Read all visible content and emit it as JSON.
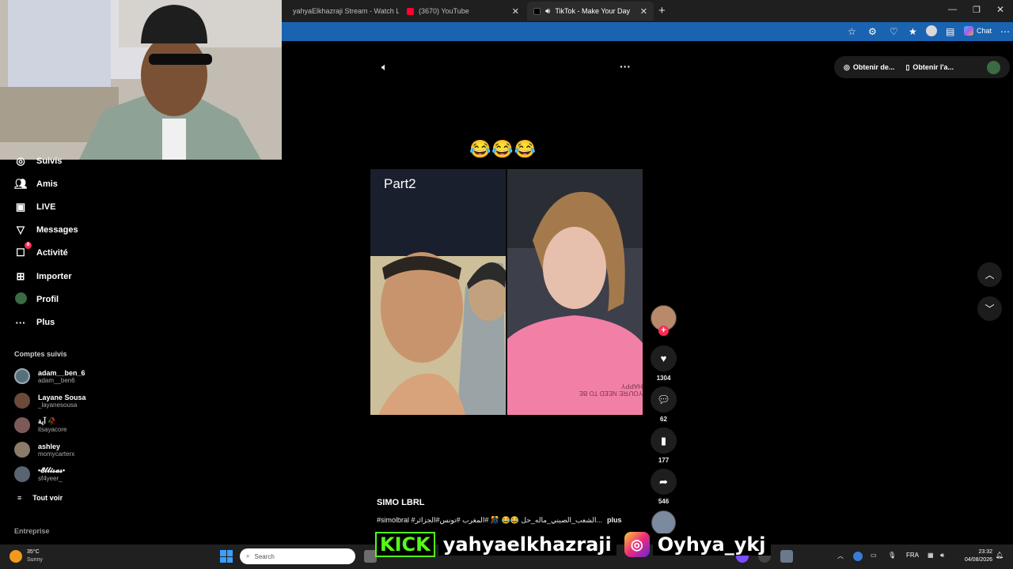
{
  "browser": {
    "tabs": [
      {
        "label": "yahyaElkhazraji Stream - Watch Li..."
      },
      {
        "label": "(3670) YouTube"
      },
      {
        "label": "TikTok - Make Your Day"
      }
    ],
    "chat_label": "Chat"
  },
  "sidebar": {
    "items": [
      {
        "label": "Suivis",
        "icon": "users-icon"
      },
      {
        "label": "Amis",
        "icon": "friends-icon"
      },
      {
        "label": "LIVE",
        "icon": "live-icon"
      },
      {
        "label": "Messages",
        "icon": "send-icon"
      },
      {
        "label": "Activité",
        "icon": "inbox-icon",
        "badge": "8"
      },
      {
        "label": "Importer",
        "icon": "plus-square-icon"
      },
      {
        "label": "Profil",
        "icon": "profile-icon"
      },
      {
        "label": "Plus",
        "icon": "more-icon"
      }
    ],
    "following_title": "Comptes suivis",
    "accounts": [
      {
        "name": "adam__ben_6",
        "handle": "adam__ben6"
      },
      {
        "name": "Layane Sousa",
        "handle": "_layanesousa"
      },
      {
        "name": "آية 🥀",
        "handle": "itsayacore"
      },
      {
        "name": "ashley",
        "handle": "momycarterx"
      },
      {
        "name": "•𝓔𝓵𝓵𝓲𝓼𝓪𝓼•",
        "handle": "sf4yeer_"
      }
    ],
    "see_all": "Tout voir",
    "footer": "Entreprise"
  },
  "topbar": {
    "get_coins": "Obtenir de...",
    "get_app": "Obtenir l'a..."
  },
  "video": {
    "caption_emojis": "😂😂😂",
    "part_label": "Part2",
    "shirt_text": "YOU'RE NEED TO BE HAPPY",
    "author": "SIMO LBRL",
    "description": "#simolbral #الشعب_الصيني_ماله_حل 😂😂 🎊 #المغرب #تونس#الجزائر...",
    "more": "plus"
  },
  "actions": {
    "likes": "1304",
    "comments": "62",
    "saves": "177",
    "shares": "546"
  },
  "overlay": {
    "kick": "KICK",
    "kick_user": "yahyaelkhazraji",
    "ig_user": "Oyhya_ykj"
  },
  "taskbar": {
    "weather_temp": "35°C",
    "weather_desc": "Sunny",
    "search_placeholder": "Search",
    "lang": "FRA",
    "time": "23:32",
    "date": "04/08/2026"
  },
  "colors": {
    "accent_red": "#fe2c55",
    "kick_green": "#53fc18",
    "browser_blue": "#1a63b0"
  }
}
